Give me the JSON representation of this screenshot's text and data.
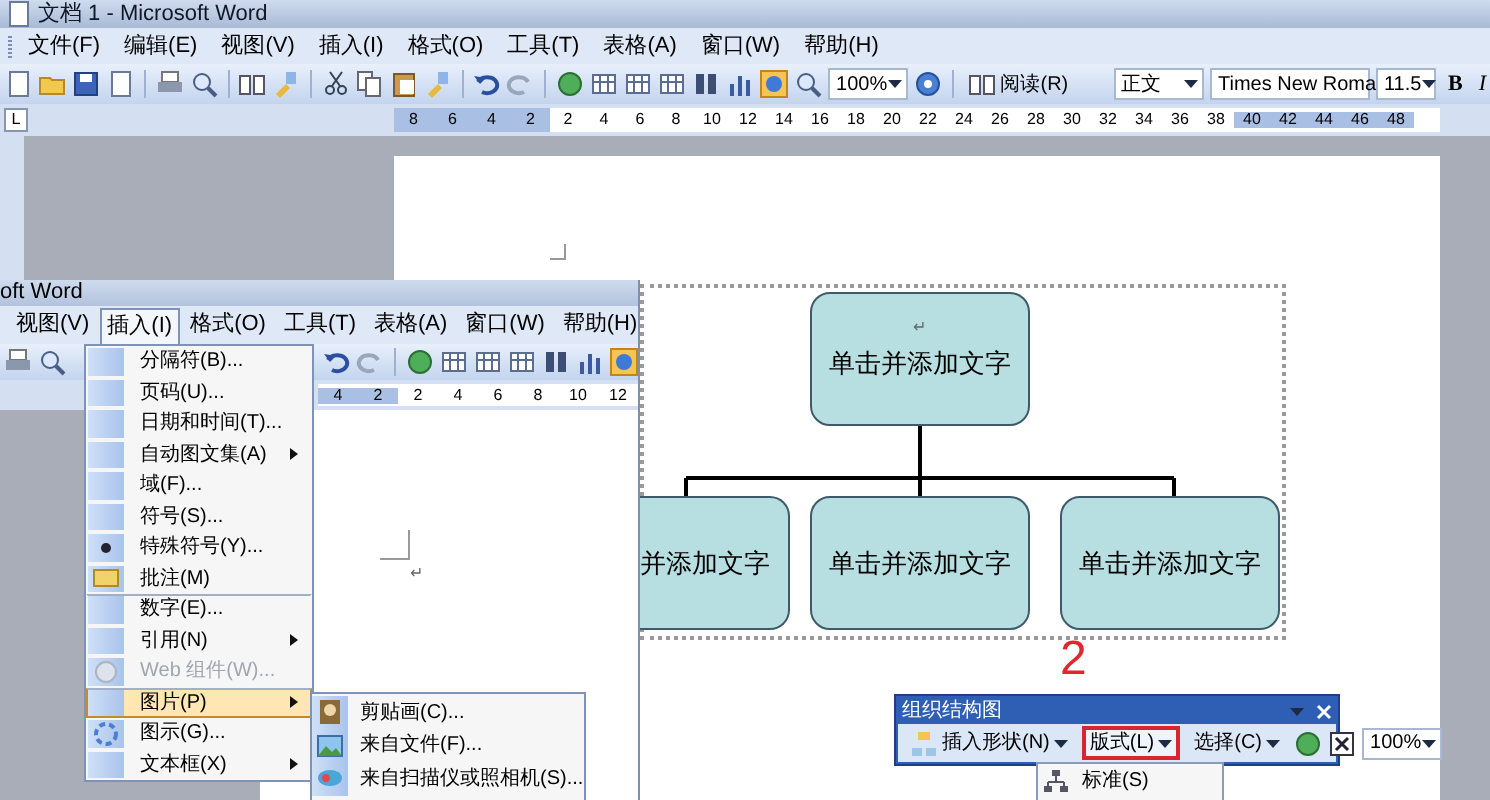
{
  "main_window": {
    "title": "文档 1 - Microsoft Word",
    "menu": [
      "文件(F)",
      "编辑(E)",
      "视图(V)",
      "插入(I)",
      "格式(O)",
      "工具(T)",
      "表格(A)",
      "窗口(W)",
      "帮助(H)"
    ],
    "toolbar": {
      "zoom": "100%",
      "read_button": "阅读(R)",
      "style": "正文",
      "font": "Times New Roma",
      "size": "11.5",
      "bold": "B",
      "italic": "I"
    },
    "tab_marker": "L",
    "ruler": {
      "left_labels": [
        "8",
        "6",
        "4",
        "2"
      ],
      "right_labels": [
        "2",
        "4",
        "6",
        "8",
        "10",
        "12",
        "14",
        "16",
        "18",
        "20",
        "22",
        "24",
        "26",
        "28",
        "30",
        "32",
        "34",
        "36",
        "38",
        "40",
        "42",
        "44",
        "46",
        "48"
      ]
    }
  },
  "org_chart": {
    "top": {
      "text": "单击并添加文字",
      "mark": "↵"
    },
    "children": [
      {
        "text": "并添加文字"
      },
      {
        "text": "单击并添加文字"
      },
      {
        "text": "单击并添加文字"
      }
    ]
  },
  "callout_number": "2",
  "org_toolbar": {
    "title": "组织结构图",
    "buttons": [
      {
        "label": "插入形状(N)",
        "highlighted": false
      },
      {
        "label": "版式(L)",
        "highlighted": true
      },
      {
        "label": "选择(C)",
        "highlighted": false
      }
    ],
    "zoom": "100%",
    "dropdown": [
      "标准(S)"
    ]
  },
  "second_window": {
    "title": "oft Word",
    "menu": [
      {
        "label": "视图(V)",
        "selected": false
      },
      {
        "label": "插入(I)",
        "selected": true
      },
      {
        "label": "格式(O)",
        "selected": false
      },
      {
        "label": "工具(T)",
        "selected": false
      },
      {
        "label": "表格(A)",
        "selected": false
      },
      {
        "label": "窗口(W)",
        "selected": false
      },
      {
        "label": "帮助(H)",
        "selected": false
      }
    ],
    "ruler_labels": [
      "4",
      "2",
      "2",
      "4",
      "6",
      "8",
      "10",
      "12"
    ],
    "paragraph_mark": "↵",
    "insert_menu": [
      {
        "label": "分隔符(B)...",
        "submenu": false,
        "disabled": false,
        "selected": false,
        "separator_before": false
      },
      {
        "label": "页码(U)...",
        "submenu": false,
        "disabled": false,
        "selected": false,
        "separator_before": false
      },
      {
        "label": "日期和时间(T)...",
        "submenu": false,
        "disabled": false,
        "selected": false,
        "separator_before": false
      },
      {
        "label": "自动图文集(A)",
        "submenu": true,
        "disabled": false,
        "selected": false,
        "separator_before": false
      },
      {
        "label": "域(F)...",
        "submenu": false,
        "disabled": false,
        "selected": false,
        "separator_before": false
      },
      {
        "label": "符号(S)...",
        "submenu": false,
        "disabled": false,
        "selected": false,
        "separator_before": false
      },
      {
        "label": "特殊符号(Y)...",
        "submenu": false,
        "disabled": false,
        "selected": false,
        "separator_before": false
      },
      {
        "label": "批注(M)",
        "submenu": false,
        "disabled": false,
        "selected": false,
        "separator_before": false
      },
      {
        "label": "数字(E)...",
        "submenu": false,
        "disabled": false,
        "selected": false,
        "separator_before": true
      },
      {
        "label": "引用(N)",
        "submenu": true,
        "disabled": false,
        "selected": false,
        "separator_before": false
      },
      {
        "label": "Web 组件(W)...",
        "submenu": false,
        "disabled": true,
        "selected": false,
        "separator_before": false
      },
      {
        "label": "图片(P)",
        "submenu": true,
        "disabled": false,
        "selected": true,
        "separator_before": true
      },
      {
        "label": "图示(G)...",
        "submenu": false,
        "disabled": false,
        "selected": false,
        "separator_before": false
      },
      {
        "label": "文本框(X)",
        "submenu": true,
        "disabled": false,
        "selected": false,
        "separator_before": false
      }
    ],
    "picture_submenu": [
      "剪贴画(C)...",
      "来自文件(F)...",
      "来自扫描仪或照相机(S)..."
    ]
  }
}
